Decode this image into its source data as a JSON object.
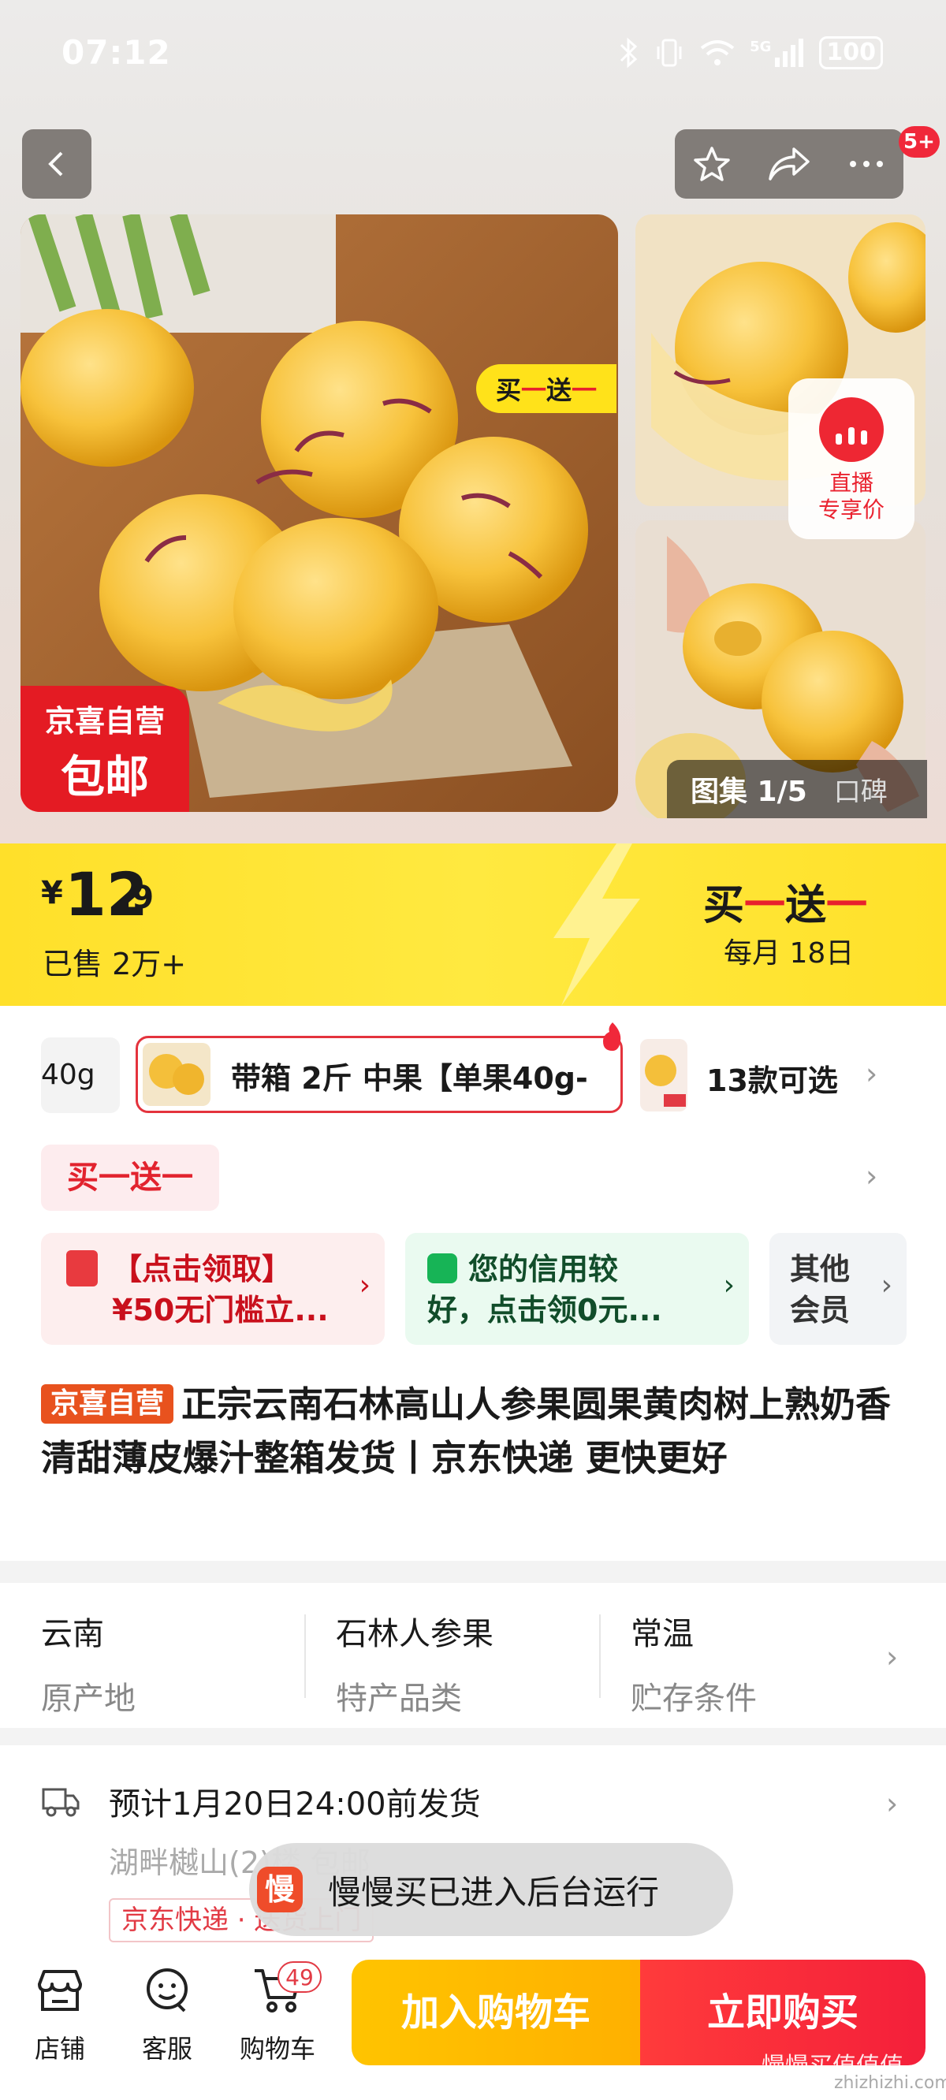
{
  "status_bar": {
    "time": "07:12",
    "network": "5G",
    "battery": "100"
  },
  "header": {
    "notification_badge": "5+"
  },
  "gallery": {
    "promo_tag": {
      "part1": "买",
      "part2": "一",
      "part3": "送",
      "part4": "一"
    },
    "badge_line1": "京喜自营",
    "badge_line2": "包邮",
    "live_line1": "直播",
    "live_line2": "专享价",
    "counter": "图集 1/5",
    "reviews_tab": "口碑"
  },
  "price": {
    "currency": "¥",
    "integer": "12",
    "decimal": ".9",
    "sold": "已售 2万+",
    "promo_part1": "买",
    "promo_part2": "一",
    "promo_part3": "送",
    "promo_part4": "一",
    "promo_date": "每月 18日"
  },
  "variants": {
    "prev_label": "40g",
    "selected_label": "带箱 2斤 中果【单果40g-",
    "count_label": "13款可选"
  },
  "promotion_chip": "买一送一",
  "coupons": [
    {
      "line1": "【点击领取】",
      "line2": "¥50无门槛立..."
    },
    {
      "line1": "您的信用较",
      "line2": "好，点击领0元..."
    },
    {
      "line1": "其他",
      "line2": "会员"
    }
  ],
  "product": {
    "tag": "京喜自营",
    "title": "正宗云南石林高山人参果圆果黄肉树上熟奶香清甜薄皮爆汁整箱发货丨京东快递 更快更好"
  },
  "specs": [
    {
      "value": "云南",
      "key": "原产地"
    },
    {
      "value": "石林人参果",
      "key": "特产品类"
    },
    {
      "value": "常温",
      "key": "贮存条件"
    }
  ],
  "shipping": {
    "estimate": "预计1月20日24:00前发货",
    "from": "湖畔樾山(2)楼 包邮",
    "chip": "京东快递 · 送货上门"
  },
  "toast": {
    "app_icon_text": "慢",
    "message": "慢慢买已进入后台运行"
  },
  "bottom_nav": {
    "store": "店铺",
    "service": "客服",
    "cart": "购物车",
    "cart_count": "49",
    "add_to_cart": "加入购物车",
    "buy_now": "立即购买"
  },
  "watermark": {
    "text": "慢慢买值值值",
    "url": "zhizhizhi.com"
  },
  "colors": {
    "accent_red": "#e8202d",
    "price_yellow": "#ffe02a",
    "cart_orange": "#ffb800"
  }
}
